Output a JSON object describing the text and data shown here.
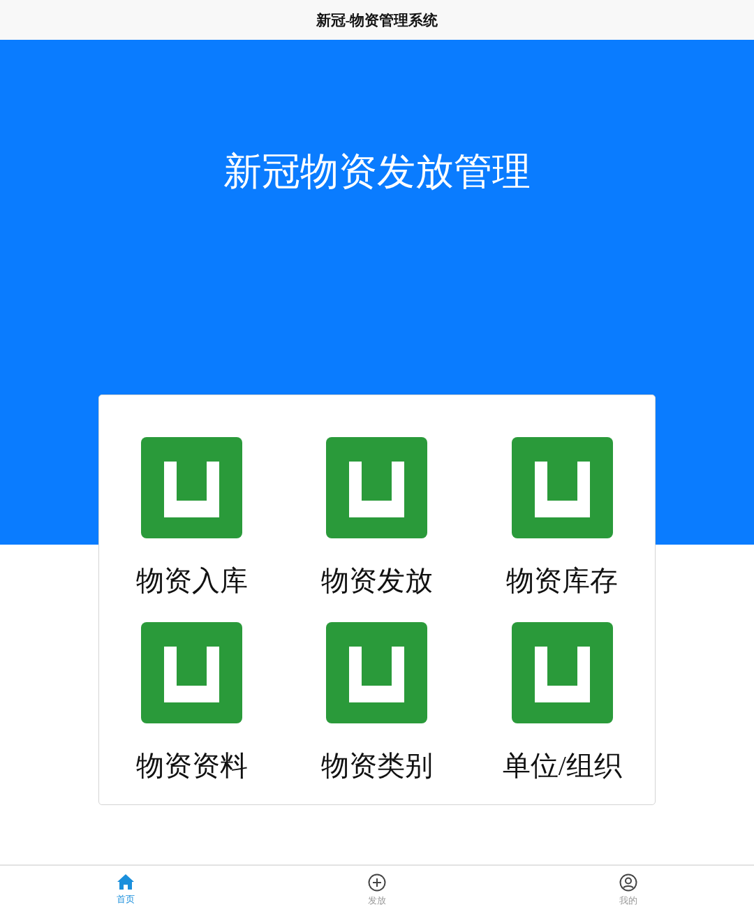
{
  "header": {
    "title": "新冠-物资管理系统"
  },
  "hero": {
    "title": "新冠物资发放管理"
  },
  "menu": [
    {
      "label": "物资入库"
    },
    {
      "label": "物资发放"
    },
    {
      "label": "物资库存"
    },
    {
      "label": "物资资料"
    },
    {
      "label": "物资类别"
    },
    {
      "label": "单位/组织"
    }
  ],
  "tab_bar": [
    {
      "kind": "home",
      "label": "首页",
      "selected": true
    },
    {
      "kind": "add",
      "label": "发放",
      "selected": false
    },
    {
      "kind": "user",
      "label": "我的",
      "selected": false
    }
  ]
}
